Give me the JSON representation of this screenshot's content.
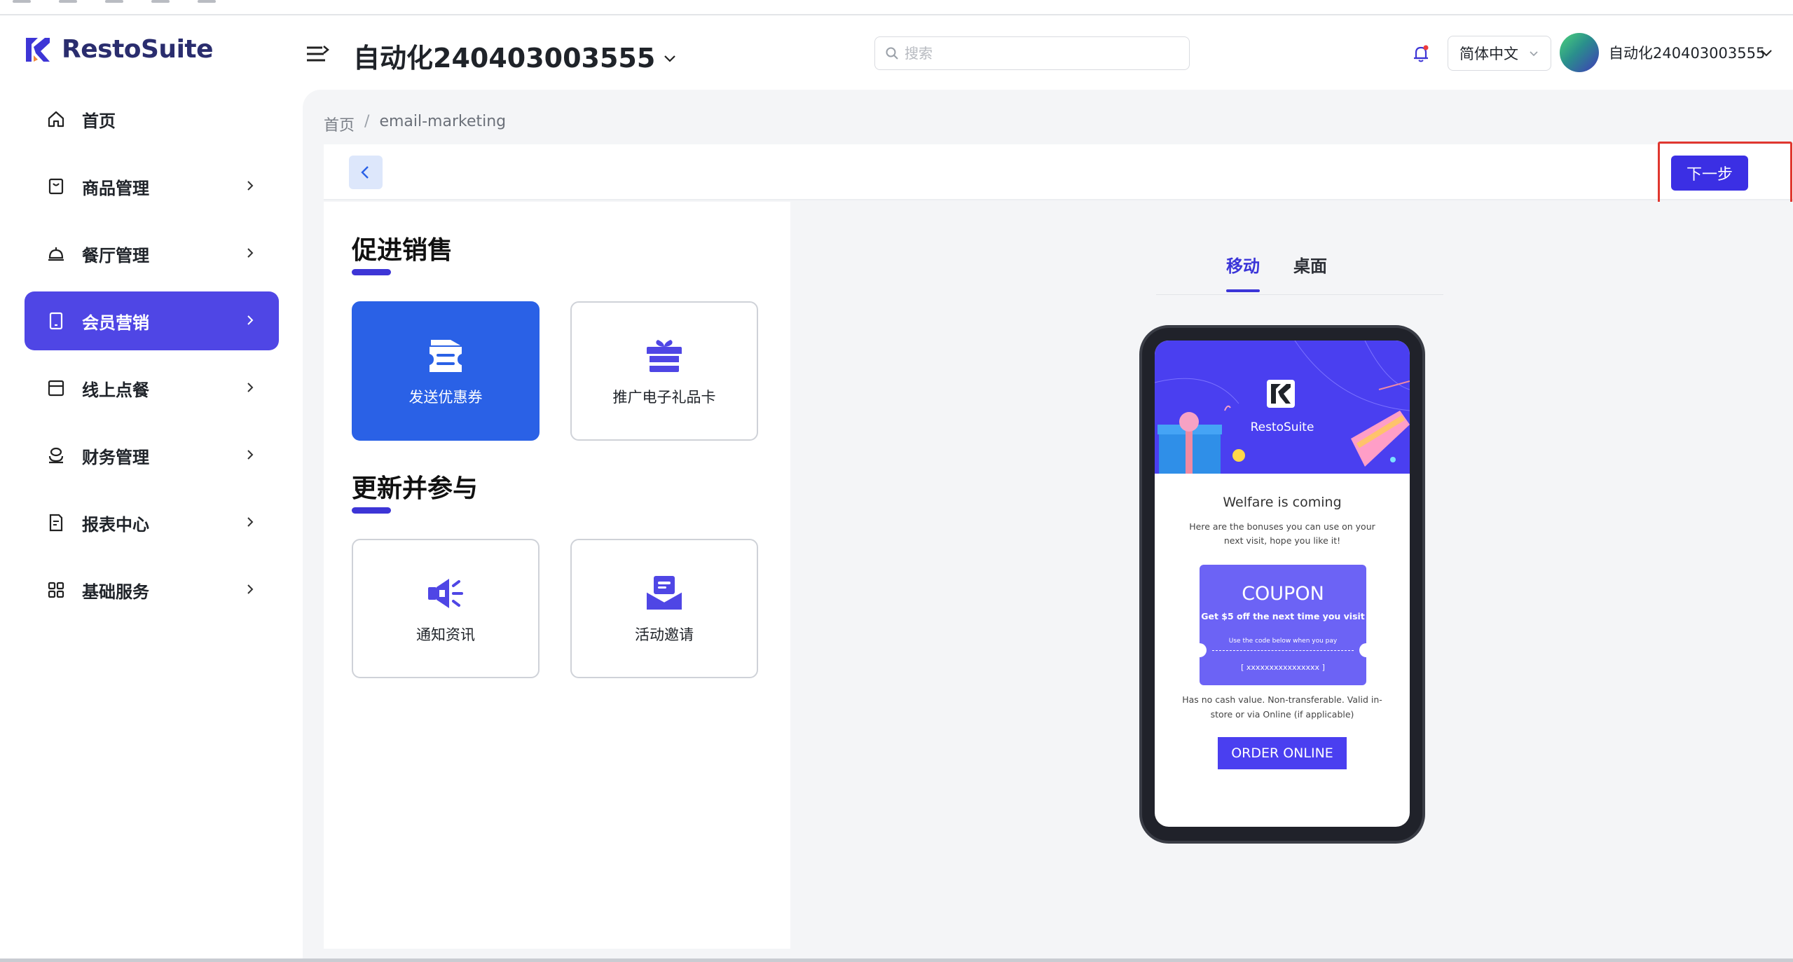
{
  "app": {
    "brand": "RestoSuite",
    "store_name": "自动化240403003555"
  },
  "header": {
    "search_placeholder": "搜索",
    "language": "简体中文",
    "user_name": "自动化240403003555"
  },
  "sidebar": {
    "items": [
      {
        "label": "首页",
        "icon": "home-icon",
        "has_children": false,
        "active": false
      },
      {
        "label": "商品管理",
        "icon": "shopping-bag-icon",
        "has_children": true,
        "active": false
      },
      {
        "label": "餐厅管理",
        "icon": "cloche-icon",
        "has_children": true,
        "active": false
      },
      {
        "label": "会员营销",
        "icon": "tablet-icon",
        "has_children": true,
        "active": true
      },
      {
        "label": "线上点餐",
        "icon": "storefront-icon",
        "has_children": true,
        "active": false
      },
      {
        "label": "财务管理",
        "icon": "coins-icon",
        "has_children": true,
        "active": false
      },
      {
        "label": "报表中心",
        "icon": "report-icon",
        "has_children": true,
        "active": false
      },
      {
        "label": "基础服务",
        "icon": "grid-icon",
        "has_children": true,
        "active": false
      }
    ]
  },
  "breadcrumb": {
    "home": "首页",
    "separator": "/",
    "current": "email-marketing"
  },
  "toolbar": {
    "next_label": "下一步"
  },
  "templates": {
    "sections": [
      {
        "title": "促进销售",
        "cards": [
          {
            "label": "发送优惠券",
            "icon": "coupon-icon",
            "selected": true
          },
          {
            "label": "推广电子礼品卡",
            "icon": "gift-icon",
            "selected": false
          }
        ]
      },
      {
        "title": "更新并参与",
        "cards": [
          {
            "label": "通知资讯",
            "icon": "megaphone-icon",
            "selected": false
          },
          {
            "label": "活动邀请",
            "icon": "envelope-icon",
            "selected": false
          }
        ]
      }
    ]
  },
  "preview": {
    "tabs": [
      {
        "label": "移动",
        "active": true
      },
      {
        "label": "桌面",
        "active": false
      }
    ],
    "email": {
      "brand": "RestoSuite",
      "heading": "Welfare is coming",
      "intro": "Here are the bonuses you can use on your next visit, hope you like it!",
      "coupon_title": "COUPON",
      "coupon_offer": "Get $5 off the next time you visit",
      "coupon_instruction": "Use the code below when you pay",
      "coupon_code": "[ xxxxxxxxxxxxxxxx ]",
      "disclaimer": "Has no cash value. Non-transferable. Valid in-store or via Online (if applicable)",
      "cta": "ORDER ONLINE"
    }
  },
  "colors": {
    "accent": "#4f46e5",
    "selected_card": "#2a61e6",
    "next_button": "#3b2fe4",
    "highlight": "#e0372f",
    "email_primary": "#4a3ff0"
  }
}
